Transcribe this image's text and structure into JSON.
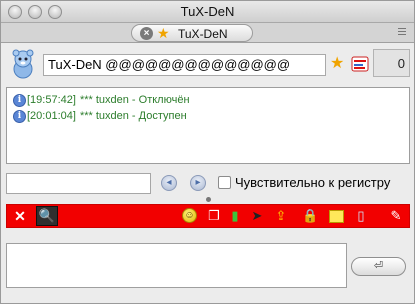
{
  "window": {
    "title": "TuX-DeN"
  },
  "tabs": [
    {
      "label": "TuX-DeN"
    }
  ],
  "contact": {
    "field_value": "TuX-DeN  @@@@@@@@@@@@@@",
    "count": "0"
  },
  "log": [
    {
      "time": "[19:57:42]",
      "text": "*** tuxden - Отключён"
    },
    {
      "time": "[20:01:04]",
      "text": "*** tuxden - Доступен"
    }
  ],
  "search": {
    "value": "",
    "case_sensitive_label": "Чувствительно к регистру"
  },
  "composer": {
    "value": "",
    "send_label": "⏎"
  },
  "icons": {
    "tab_close": "×",
    "star": "★",
    "info": "i",
    "prev": "◂",
    "next": "▸",
    "close": "✕",
    "search": "🔍",
    "smiley": "☺",
    "files": "❐",
    "book": "▮",
    "send_file": "➤",
    "upload": "⇪",
    "lock": "🔒",
    "book2": "▯",
    "doc": "✎"
  }
}
